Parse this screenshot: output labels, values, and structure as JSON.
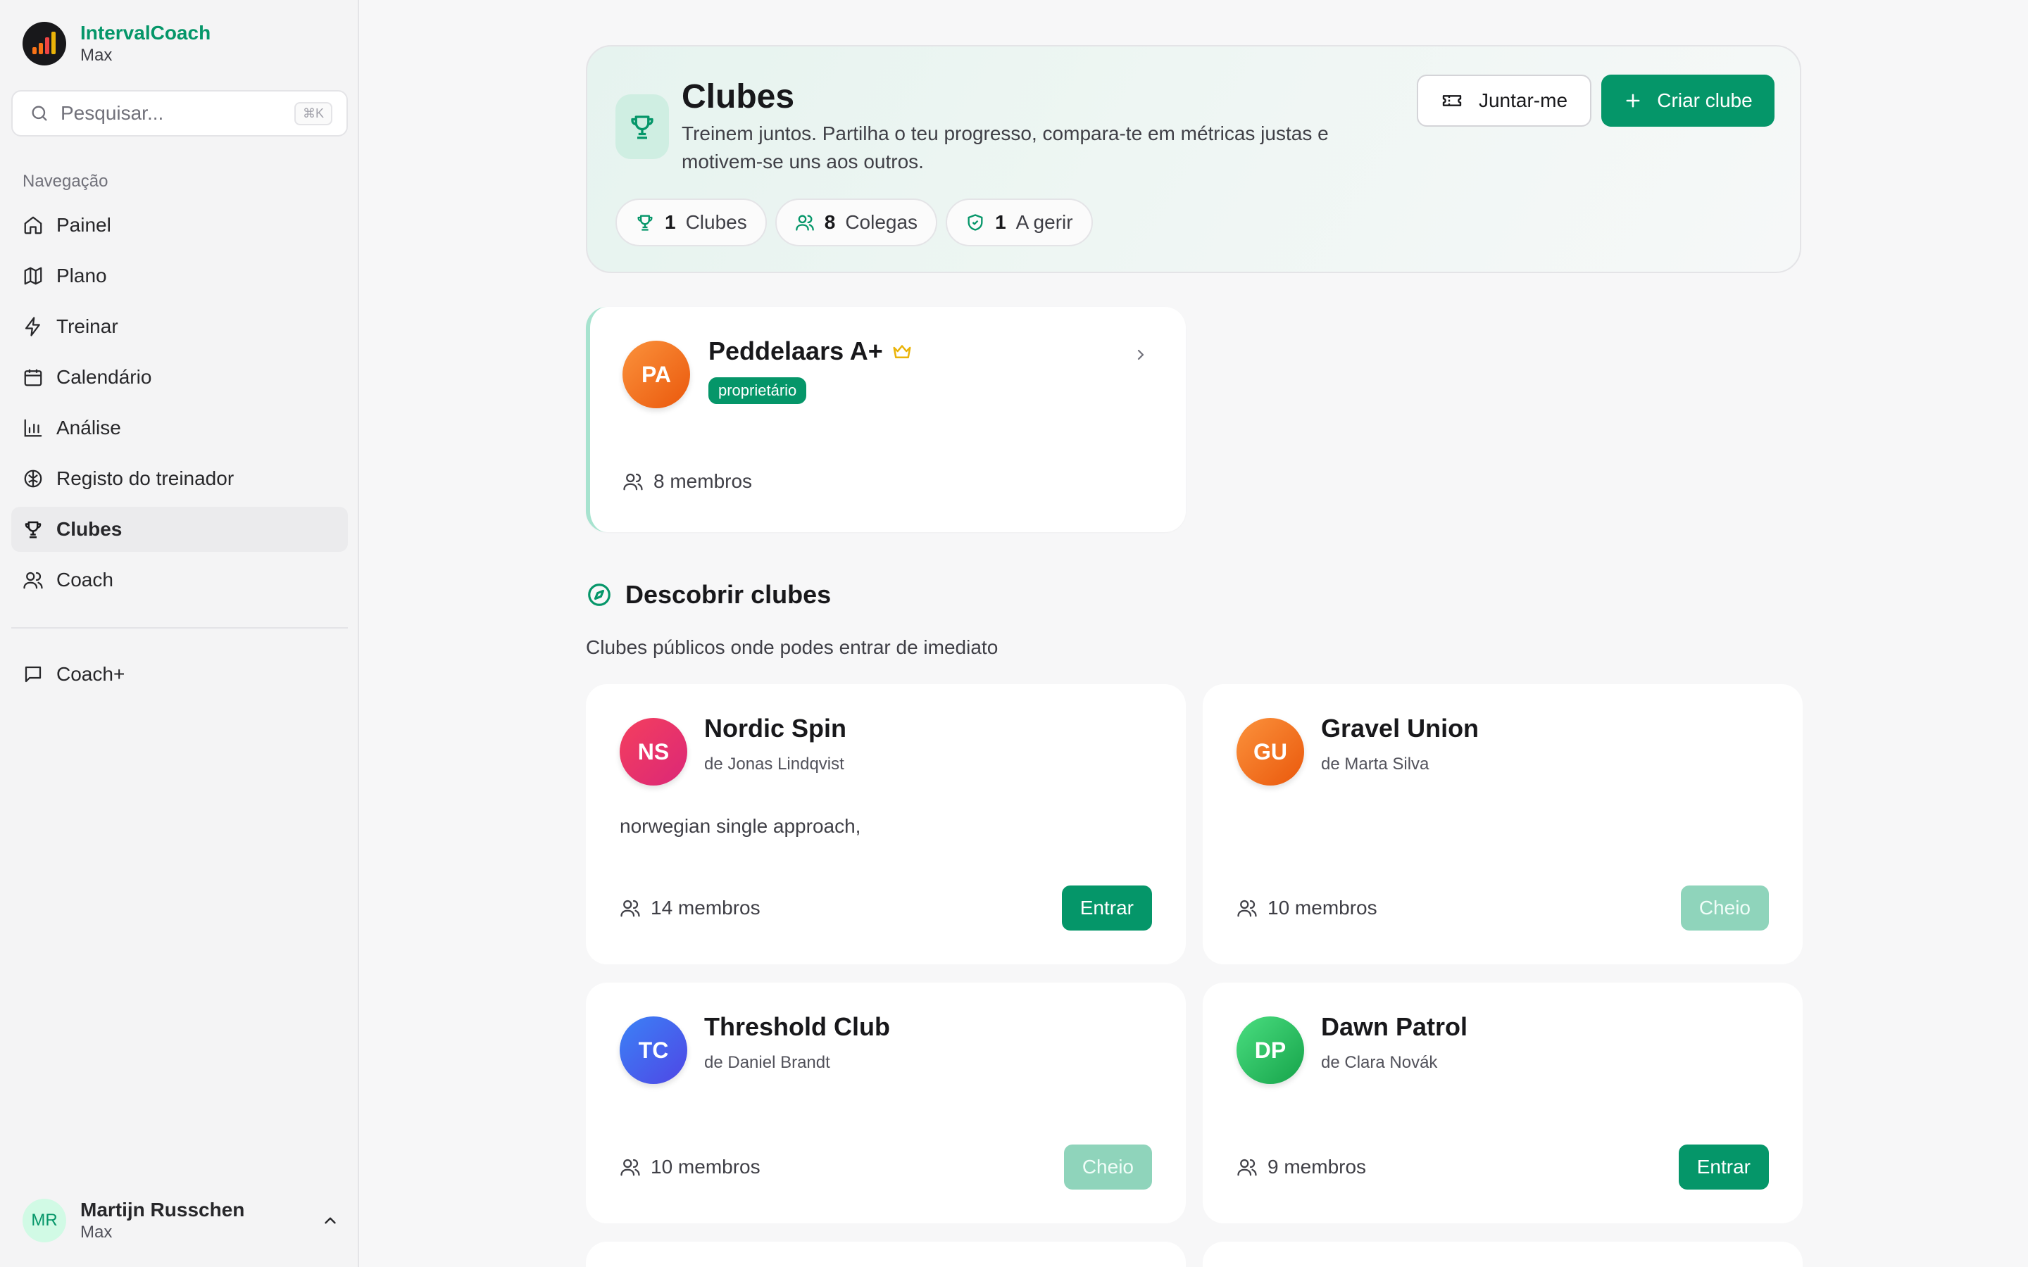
{
  "app": {
    "name": "IntervalCoach",
    "subtitle": "Max"
  },
  "search": {
    "placeholder": "Pesquisar...",
    "shortcut": "⌘K"
  },
  "nav": {
    "heading": "Navegação",
    "items": [
      {
        "label": "Painel",
        "icon": "home-icon"
      },
      {
        "label": "Plano",
        "icon": "map-icon"
      },
      {
        "label": "Treinar",
        "icon": "bolt-icon"
      },
      {
        "label": "Calendário",
        "icon": "calendar-icon"
      },
      {
        "label": "Análise",
        "icon": "bar-chart-icon"
      },
      {
        "label": "Registo do treinador",
        "icon": "brain-icon"
      },
      {
        "label": "Clubes",
        "icon": "trophy-icon",
        "active": true
      },
      {
        "label": "Coach",
        "icon": "users-icon"
      }
    ],
    "secondary": [
      {
        "label": "Coach+",
        "icon": "chat-icon"
      }
    ]
  },
  "user": {
    "initials": "MR",
    "name": "Martijn Russchen",
    "subtitle": "Max"
  },
  "header": {
    "title": "Clubes",
    "description": "Treinem juntos. Partilha o teu progresso, compara-te em métricas justas e motivem-se uns aos outros.",
    "join_label": "Juntar-me",
    "create_label": "Criar clube",
    "stats": [
      {
        "value": "1",
        "label": "Clubes"
      },
      {
        "value": "8",
        "label": "Colegas"
      },
      {
        "value": "1",
        "label": "A gerir"
      }
    ]
  },
  "my_club": {
    "initials": "PA",
    "name": "Peddelaars A+",
    "badge": "proprietário",
    "members": "8 membros"
  },
  "discover": {
    "title": "Descobrir clubes",
    "description": "Clubes públicos onde podes entrar de imediato",
    "clubs": [
      {
        "initials": "NS",
        "name": "Nordic Spin",
        "owner": "de Jonas Lindqvist",
        "description": "norwegian single approach,",
        "members": "14 membros",
        "action": "Entrar",
        "full": false
      },
      {
        "initials": "GU",
        "name": "Gravel Union",
        "owner": "de Marta Silva",
        "description": "",
        "members": "10 membros",
        "action": "Cheio",
        "full": true
      },
      {
        "initials": "TC",
        "name": "Threshold Club",
        "owner": "de Daniel Brandt",
        "description": "",
        "members": "10 membros",
        "action": "Cheio",
        "full": true
      },
      {
        "initials": "DP",
        "name": "Dawn Patrol",
        "owner": "de Clara Novák",
        "description": "",
        "members": "9 membros",
        "action": "Entrar",
        "full": false
      }
    ]
  },
  "colors": {
    "accent": "#059669",
    "crown": "#eab308"
  }
}
